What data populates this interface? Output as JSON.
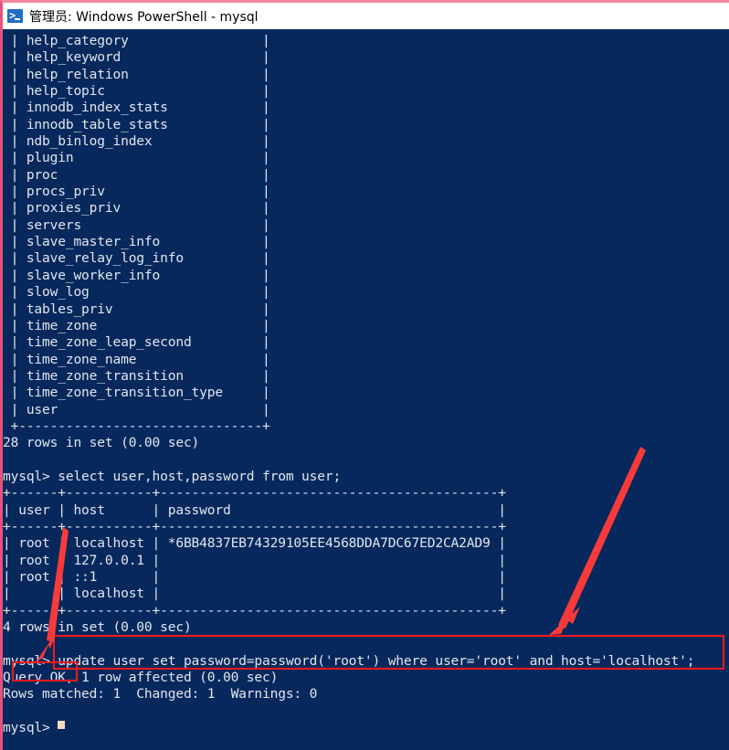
{
  "window": {
    "title": "管理员: Windows PowerShell - mysql",
    "icon": "powershell-icon",
    "background_color": "#06285c",
    "text_color": "#e2e6ee",
    "titlebar_color": "#ffffff",
    "annotation_color": "#f21b1b",
    "cursor_color": "#f3debb"
  },
  "terminal": {
    "content": " | help_category                 |\n | help_keyword                  |\n | help_relation                 |\n | help_topic                    |\n | innodb_index_stats            |\n | innodb_table_stats            |\n | ndb_binlog_index              |\n | plugin                        |\n | proc                          |\n | procs_priv                    |\n | proxies_priv                  |\n | servers                       |\n | slave_master_info             |\n | slave_relay_log_info          |\n | slave_worker_info             |\n | slow_log                      |\n | tables_priv                   |\n | time_zone                     |\n | time_zone_leap_second         |\n | time_zone_name                |\n | time_zone_transition          |\n | time_zone_transition_type     |\n | user                          |\n +-------------------------------+\n28 rows in set (0.00 sec)\n\nmysql> select user,host,password from user;\n+------+-----------+-------------------------------------------+\n| user | host      | password                                  |\n+------+-----------+-------------------------------------------+\n| root | localhost | *6BB4837EB74329105EE4568DDA7DC67ED2CA2AD9 |\n| root | 127.0.0.1 |                                           |\n| root | ::1       |                                           |\n|      | localhost |                                           |\n+------+-----------+-------------------------------------------+\n4 rows in set (0.00 sec)\n\nmysql> update user set password=password('root') where user='root' and host='localhost';\nQuery OK, 1 row affected (0.00 sec)\nRows matched: 1  Changed: 1  Warnings: 0\n\nmysql> ",
    "tables_listing": [
      "help_category",
      "help_keyword",
      "help_relation",
      "help_topic",
      "innodb_index_stats",
      "innodb_table_stats",
      "ndb_binlog_index",
      "plugin",
      "proc",
      "procs_priv",
      "proxies_priv",
      "servers",
      "slave_master_info",
      "slave_relay_log_info",
      "slave_worker_info",
      "slow_log",
      "tables_priv",
      "time_zone",
      "time_zone_leap_second",
      "time_zone_name",
      "time_zone_transition",
      "time_zone_transition_type",
      "user"
    ],
    "tables_listing_status": "28 rows in set (0.00 sec)",
    "select_command": "mysql> select user,host,password from user;",
    "user_table": {
      "headers": [
        "user",
        "host",
        "password"
      ],
      "rows": [
        [
          "root",
          "localhost",
          "*6BB4837EB74329105EE4568DDA7DC67ED2CA2AD9"
        ],
        [
          "root",
          "127.0.0.1",
          ""
        ],
        [
          "root",
          "::1",
          ""
        ],
        [
          "",
          "localhost",
          ""
        ]
      ]
    },
    "select_status": "4 rows in set (0.00 sec)",
    "update_command": "mysql> update user set password=password('root') where user='root' and host='localhost';",
    "update_result": "Query OK, 1 row affected (0.00 sec)",
    "update_detail": "Rows matched: 1  Changed: 1  Warnings: 0",
    "final_prompt": "mysql> "
  },
  "annotations": {
    "box_update_label": "highlight-update-statement",
    "box_queryok_label": "highlight-query-ok",
    "arrow_left_label": "arrow-pointing-to-prompt",
    "arrow_right_label": "arrow-pointing-to-update-statement"
  }
}
